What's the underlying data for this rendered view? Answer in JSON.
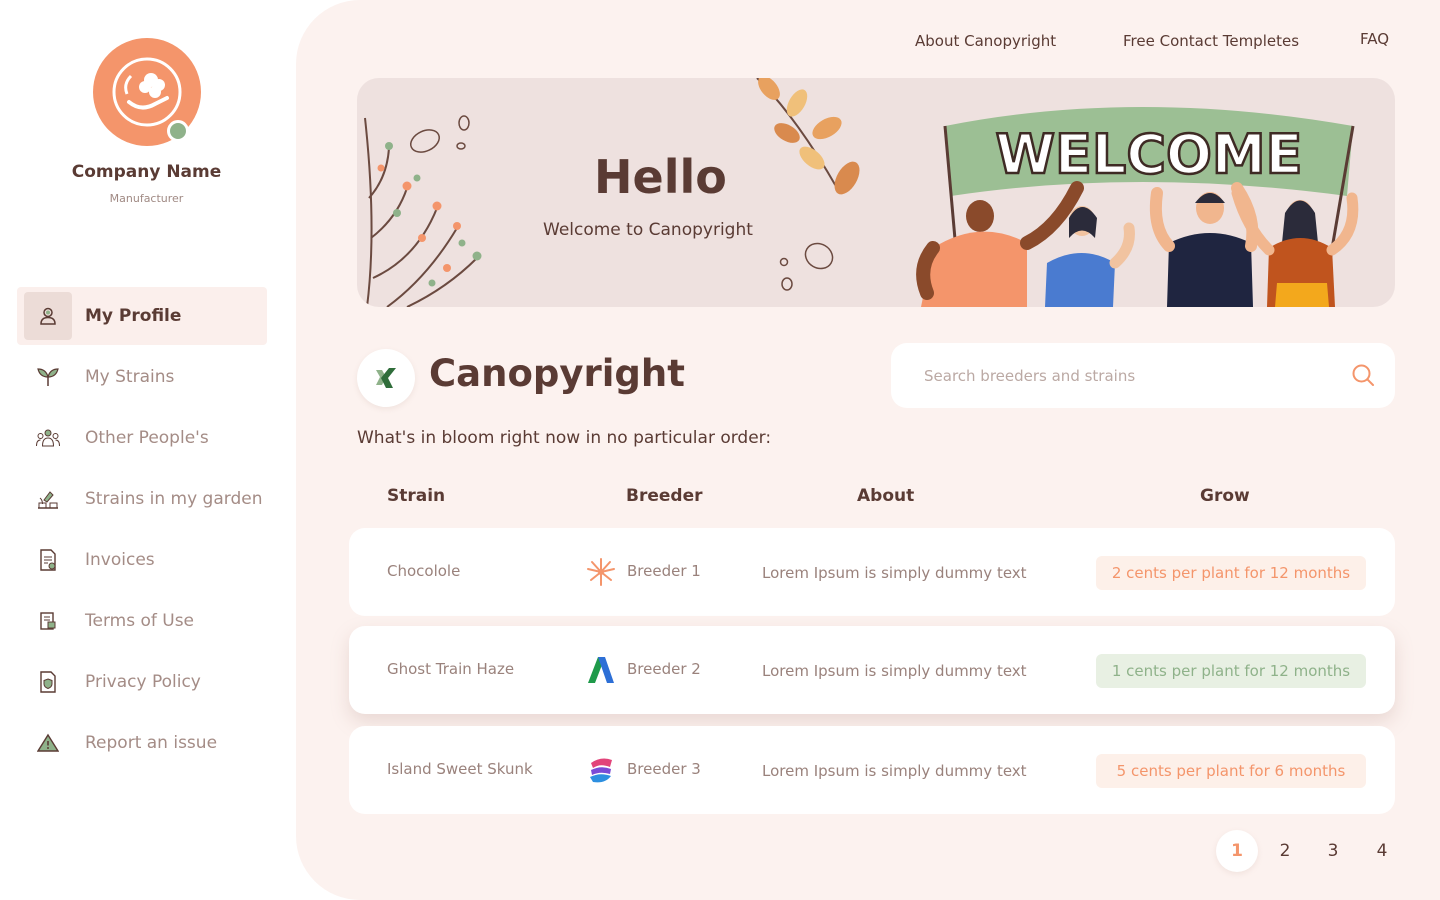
{
  "company": {
    "name": "Company Name",
    "role": "Manufacturer"
  },
  "nav": [
    {
      "label": "My Profile",
      "icon": "user-icon",
      "active": true
    },
    {
      "label": "My Strains",
      "icon": "sprout-icon"
    },
    {
      "label": "Other People's",
      "icon": "people-icon"
    },
    {
      "label": "Strains in my garden",
      "icon": "garden-icon"
    },
    {
      "label": "Invoices",
      "icon": "invoice-icon"
    },
    {
      "label": "Terms of Use",
      "icon": "document-icon"
    },
    {
      "label": "Privacy Policy",
      "icon": "shield-document-icon"
    },
    {
      "label": "Report an issue",
      "icon": "warning-icon"
    }
  ],
  "top_links": {
    "about": "About  Canopyright",
    "templates": "Free Contact Templetes",
    "faq": "FAQ"
  },
  "banner": {
    "hello": "Hello",
    "subtitle": "Welcome to Canopyright",
    "flag_text": "WELCOME"
  },
  "brand": {
    "title": "Canopyright"
  },
  "search": {
    "placeholder": "Search breeders and strains"
  },
  "intro": "What's in bloom right now in no particular order:",
  "table": {
    "headers": {
      "strain": "Strain",
      "breeder": "Breeder",
      "about": "About",
      "grow": "Grow"
    },
    "rows": [
      {
        "strain": "Chocolole",
        "breeder": "Breeder 1",
        "about": "Lorem Ipsum is simply dummy text",
        "grow": "2 cents per plant for 12 months",
        "grow_color": "#f4956b"
      },
      {
        "strain": "Ghost Train Haze",
        "breeder": "Breeder 2",
        "about": "Lorem Ipsum is simply dummy text",
        "grow": "1 cents per plant for 12 months",
        "grow_color": "#8fb28a"
      },
      {
        "strain": "Island Sweet Skunk",
        "breeder": "Breeder 3",
        "about": "Lorem Ipsum is simply dummy text",
        "grow": "5 cents per plant for 6 months",
        "grow_color": "#f4956b"
      }
    ]
  },
  "pagination": {
    "pages": [
      "1",
      "2",
      "3",
      "4"
    ],
    "current": "1"
  },
  "colors": {
    "accent": "#f4956b",
    "green": "#8fb28a",
    "text": "#5a3b34",
    "background": "#fcf2ef"
  }
}
